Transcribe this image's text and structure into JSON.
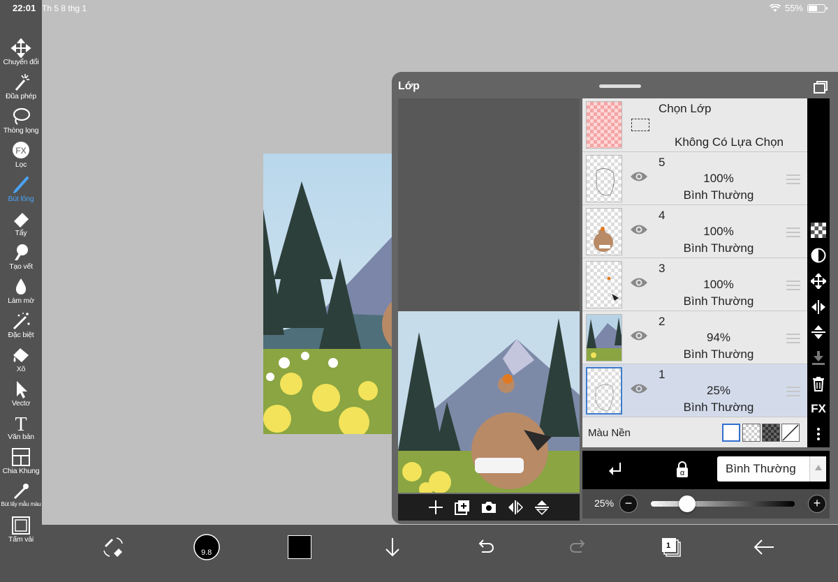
{
  "status_bar": {
    "time": "22:01",
    "date": "Th 5 8 thg 1",
    "battery": "55%",
    "battery_level": 0.55
  },
  "toolbar": {
    "items": [
      {
        "label": "Chuyển đổi",
        "icon": "move-icon"
      },
      {
        "label": "Đũa phép",
        "icon": "magic-wand-icon"
      },
      {
        "label": "Thòng lọng",
        "icon": "lasso-icon"
      },
      {
        "label": "Lọc",
        "icon": "fx-icon"
      },
      {
        "label": "Bút lông",
        "icon": "brush-icon",
        "active": true
      },
      {
        "label": "Tẩy",
        "icon": "eraser-icon"
      },
      {
        "label": "Tạo vết",
        "icon": "smudge-icon"
      },
      {
        "label": "Làm mờ",
        "icon": "blur-icon"
      },
      {
        "label": "Đặc biệt",
        "icon": "special-brush-icon"
      },
      {
        "label": "Xô",
        "icon": "bucket-icon"
      },
      {
        "label": "Vectơ",
        "icon": "vector-icon"
      },
      {
        "label": "Văn bản",
        "icon": "text-icon"
      },
      {
        "label": "Chia Khung",
        "icon": "frame-divider-icon"
      },
      {
        "label": "Bút lấy mẫu màu",
        "icon": "eyedropper-icon"
      },
      {
        "label": "Tấm vải",
        "icon": "canvas-icon"
      }
    ],
    "active_color": "#4aa3f5"
  },
  "bottom_bar": {
    "brush_size": "9.8",
    "color": "#000000",
    "layer_count": "1"
  },
  "layer_panel": {
    "title": "Lớp",
    "selection_layer": {
      "title": "Chọn Lớp",
      "subtitle": "Không Có Lựa Chọn"
    },
    "layers": [
      {
        "number": "5",
        "opacity": "100%",
        "blend": "Bình Thường"
      },
      {
        "number": "4",
        "opacity": "100%",
        "blend": "Bình Thường"
      },
      {
        "number": "3",
        "opacity": "100%",
        "blend": "Bình Thường"
      },
      {
        "number": "2",
        "opacity": "94%",
        "blend": "Bình Thường"
      },
      {
        "number": "1",
        "opacity": "25%",
        "blend": "Bình Thường",
        "selected": true
      }
    ],
    "background_label": "Màu Nền",
    "blend_mode": "Bình Thường",
    "opacity_label": "25%",
    "opacity_value": 0.25,
    "side_tools": [
      "checker-icon",
      "contrast-icon",
      "move-icon",
      "flip-horizontal-icon",
      "flip-vertical-icon",
      "merge-down-icon",
      "trash-icon",
      "FX",
      "more-icon"
    ],
    "selected_color": "#3f7ccc"
  }
}
